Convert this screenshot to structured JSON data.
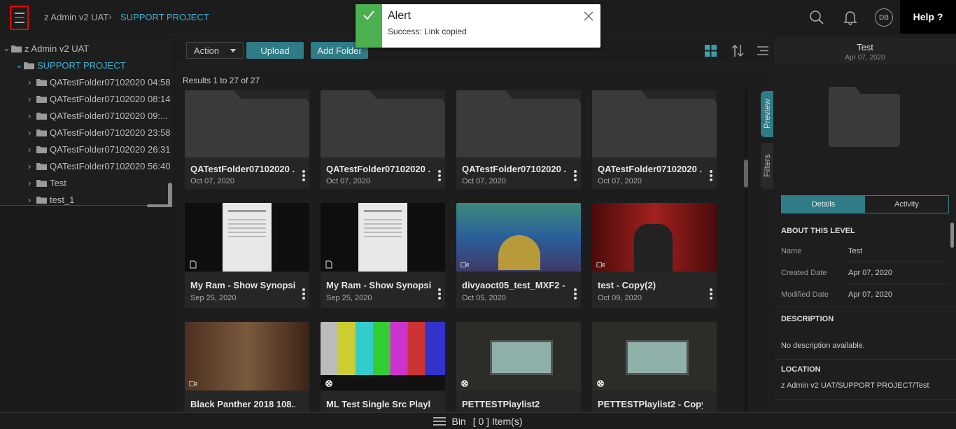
{
  "header": {
    "breadcrumb_root": "z Admin v2 UAT",
    "breadcrumb_current": "SUPPORT PROJECT",
    "avatar_initials": "DB",
    "help_label": "Help ?"
  },
  "alert": {
    "title": "Alert",
    "message": "Success: Link copied",
    "color": "#4caf50"
  },
  "sidebar": {
    "root": "z Admin v2 UAT",
    "project": "SUPPORT PROJECT",
    "items": [
      "QATestFolder07102020 04:58",
      "QATestFolder07102020 08:14",
      "QATestFolder07102020 09:...",
      "QATestFolder07102020 23:58",
      "QATestFolder07102020 26:31",
      "QATestFolder07102020 56:40",
      "Test",
      "test_1"
    ]
  },
  "toolbar": {
    "action_label": "Action",
    "upload_label": "Upload",
    "add_folder_label": "Add Folder"
  },
  "results_text": "Results 1 to 27 of 27",
  "cards": [
    {
      "title": "QATestFolder07102020 ...",
      "date": "Oct 07, 2020",
      "kind": "folder"
    },
    {
      "title": "QATestFolder07102020 ...",
      "date": "Oct 07, 2020",
      "kind": "folder"
    },
    {
      "title": "QATestFolder07102020 ...",
      "date": "Oct 07, 2020",
      "kind": "folder"
    },
    {
      "title": "QATestFolder07102020 ...",
      "date": "Oct 07, 2020",
      "kind": "folder"
    },
    {
      "title": "My Ram - Show Synopsis...",
      "date": "Sep 25, 2020",
      "kind": "document"
    },
    {
      "title": "My Ram - Show Synopsis",
      "date": "Sep 25, 2020",
      "kind": "document"
    },
    {
      "title": "divyaoct05_test_MXF2 - ...",
      "date": "Oct 05, 2020",
      "kind": "video"
    },
    {
      "title": "test - Copy(2)",
      "date": "Oct 09, 2020",
      "kind": "video"
    },
    {
      "title": "Black Panther 2018 108...",
      "date": "",
      "kind": "video"
    },
    {
      "title": "ML Test Single Src Playlist",
      "date": "",
      "kind": "playlist"
    },
    {
      "title": "PETTESTPlaylist2",
      "date": "",
      "kind": "playlist"
    },
    {
      "title": "PETTESTPlaylist2 - Copy",
      "date": "",
      "kind": "playlist"
    }
  ],
  "side_tabs": {
    "preview": "Preview",
    "filters": "Filters"
  },
  "right_panel": {
    "title": "Test",
    "date": "Apr 07, 2020",
    "tabs": [
      "Details",
      "Activity"
    ],
    "about_heading": "ABOUT THIS LEVEL",
    "name_label": "Name",
    "name_value": "Test",
    "created_label": "Created Date",
    "created_value": "Apr 07, 2020",
    "modified_label": "Modified Date",
    "modified_value": "Apr 07, 2020",
    "description_heading": "DESCRIPTION",
    "description_value": "No description available.",
    "location_heading": "LOCATION",
    "location_value": "z Admin v2 UAT/SUPPORT PROJECT/Test"
  },
  "bin": {
    "label": "Bin",
    "count_text": "[ 0 ] Item(s)"
  },
  "colors": {
    "accent": "#3bb3d6",
    "teal_button": "#2f7b86"
  },
  "icons": [
    "menu-icon",
    "search-icon",
    "bell-icon",
    "folder-icon",
    "grid-view-icon",
    "sort-icon",
    "list-view-icon",
    "close-icon",
    "check-icon"
  ]
}
